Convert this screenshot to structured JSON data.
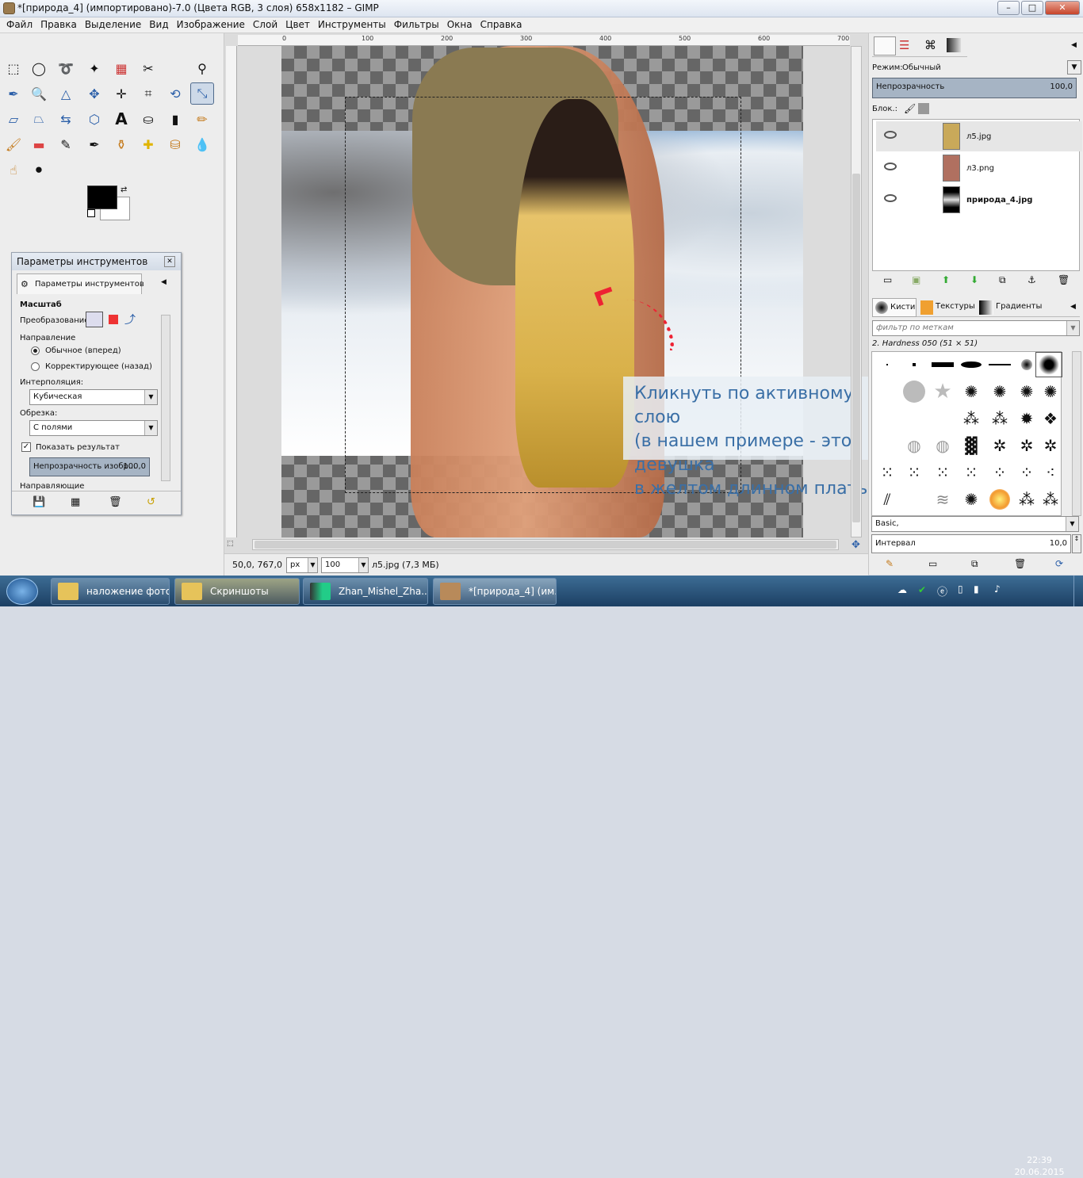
{
  "window": {
    "title": "*[природа_4] (импортировано)-7.0 (Цвета RGB, 3 слоя) 658x1182 – GIMP",
    "minimize": "–",
    "maximize": "□",
    "close": "✕"
  },
  "menu": [
    {
      "label": "Файл"
    },
    {
      "label": "Правка"
    },
    {
      "label": "Выделение"
    },
    {
      "label": "Вид"
    },
    {
      "label": "Изображение"
    },
    {
      "label": "Слой"
    },
    {
      "label": "Цвет"
    },
    {
      "label": "Инструменты"
    },
    {
      "label": "Фильтры"
    },
    {
      "label": "Окна"
    },
    {
      "label": "Справка"
    }
  ],
  "ruler": {
    "h": [
      "0",
      "100",
      "200",
      "300",
      "400",
      "500",
      "600",
      "700"
    ]
  },
  "tool_options": {
    "dialog_title": "Параметры инструментов",
    "tab_label": "Параметры инструментов",
    "section": "Масштаб",
    "transform_label": "Преобразование:",
    "direction_label": "Направление",
    "direction_normal": "Обычное (вперед)",
    "direction_corrective": "Корректирующее (назад)",
    "interpolation_label": "Интерполяция:",
    "interpolation_value": "Кубическая",
    "clipping_label": "Обрезка:",
    "clipping_value": "С полями",
    "show_preview": "Показать результат",
    "opacity_label": "Непрозрачность изобр...",
    "opacity_value": "100,0",
    "guides_label": "Направляющие"
  },
  "callout": {
    "line1": "Кликнуть по активному слою",
    "line2": "(в нашем примере - это девушка",
    "line3": "в желтом длинном платье)"
  },
  "status": {
    "coords": "50,0, 767,0",
    "unit": "px",
    "zoom": "100",
    "layer_info": "л5.jpg (7,3 МБ)"
  },
  "layers_panel": {
    "mode_label": "Режим:",
    "mode_value": "Обычный",
    "opacity_label": "Непрозрачность",
    "opacity_value": "100,0",
    "lock_label": "Блок.:",
    "layers": [
      {
        "name": "л5.jpg"
      },
      {
        "name": "л3.png"
      },
      {
        "name": "природа_4.jpg"
      }
    ]
  },
  "brushes_panel": {
    "tabs": [
      {
        "label": "Кисти"
      },
      {
        "label": "Текстуры"
      },
      {
        "label": "Градиенты"
      }
    ],
    "filter_placeholder": "фильтр по меткам",
    "brush_name": "2. Hardness 050 (51 × 51)",
    "preset": "Basic,",
    "spacing_label": "Интервал",
    "spacing_value": "10,0"
  },
  "taskbar": {
    "items": [
      {
        "label": "наложение фото"
      },
      {
        "label": "Скриншоты"
      },
      {
        "label": "Zhan_Mishel_Zha..."
      },
      {
        "label": "*[природа_4] (им..."
      }
    ],
    "time": "22:39",
    "date": "20.06.2015"
  }
}
